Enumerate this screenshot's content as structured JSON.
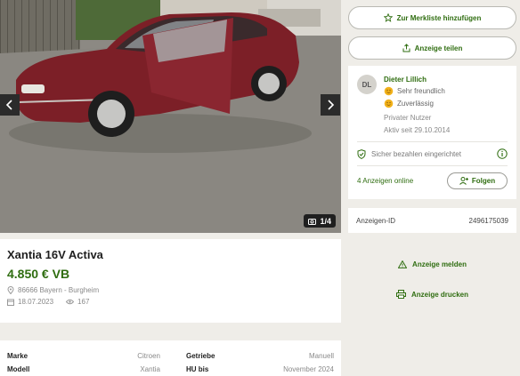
{
  "gallery": {
    "counter": "1/4"
  },
  "listing": {
    "title": "Xantia 16V Activa",
    "price": "4.850 € VB",
    "location": "86666 Bayern - Burgheim",
    "date": "18.07.2023",
    "views": "167"
  },
  "details": [
    {
      "label": "Marke",
      "value": "Citroen",
      "label2": "Getriebe",
      "value2": "Manuell"
    },
    {
      "label": "Modell",
      "value": "Xantia",
      "label2": "HU bis",
      "value2": "November 2024"
    }
  ],
  "actions": {
    "watchlist": "Zur Merkliste hinzufügen",
    "share": "Anzeige teilen",
    "report": "Anzeige melden",
    "print": "Anzeige drucken"
  },
  "seller": {
    "initials": "DL",
    "name": "Dieter Lillich",
    "badge1": "Sehr freundlich",
    "badge2": "Zuverlässig",
    "type": "Privater Nutzer",
    "active_since": "Aktiv seit 29.10.2014",
    "secure_payment": "Sicher bezahlen eingerichtet",
    "ads_online": "4 Anzeigen online",
    "follow": "Folgen"
  },
  "ad_id": {
    "label": "Anzeigen-ID",
    "value": "2496175039"
  },
  "colors": {
    "accent": "#2f6d10",
    "background": "#efede8",
    "car": "#7c1f27"
  },
  "icons": [
    "chevron-left-icon",
    "chevron-right-icon",
    "camera-icon",
    "location-pin-icon",
    "calendar-icon",
    "eye-icon",
    "star-icon",
    "share-icon",
    "smiley-icon",
    "shield-icon",
    "info-icon",
    "person-plus-icon",
    "warning-icon",
    "printer-icon"
  ]
}
